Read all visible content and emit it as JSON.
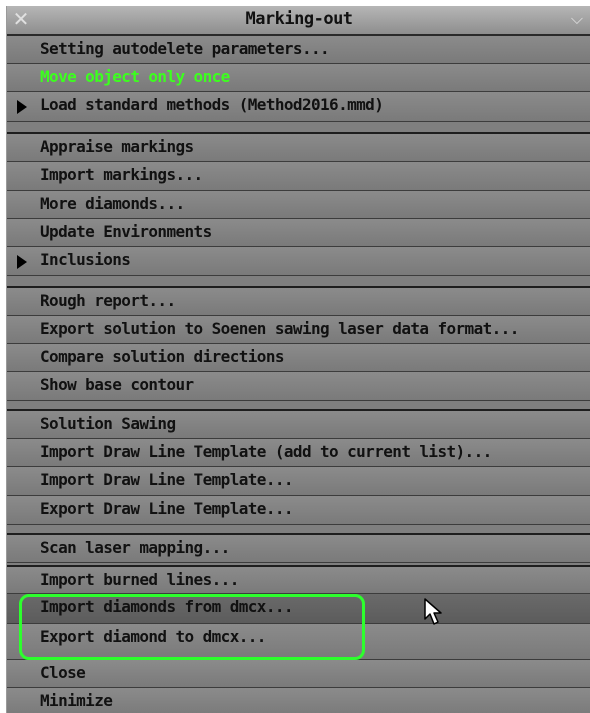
{
  "window": {
    "title": "Marking-out",
    "close_glyph": "✕",
    "dropdown_glyph": "⌵"
  },
  "items": [
    {
      "label": "Setting autodelete parameters..."
    },
    {
      "label": "Move object only once"
    },
    {
      "label": "Load standard methods (Method2016.mmd)"
    },
    {
      "label": "Appraise markings"
    },
    {
      "label": "Import markings..."
    },
    {
      "label": "More diamonds..."
    },
    {
      "label": "Update Environments"
    },
    {
      "label": "Inclusions"
    },
    {
      "label": "Rough report..."
    },
    {
      "label": "Export solution to Soenen sawing laser data format..."
    },
    {
      "label": "Compare solution directions"
    },
    {
      "label": "Show base contour"
    },
    {
      "label": "Solution Sawing"
    },
    {
      "label": "Import Draw Line Template (add to current list)..."
    },
    {
      "label": "Import Draw Line Template..."
    },
    {
      "label": "Export Draw Line Template..."
    },
    {
      "label": "Scan laser mapping..."
    },
    {
      "label": "Import burned lines..."
    },
    {
      "label": "Import diamonds from dmcx..."
    },
    {
      "label": "Export diamond to dmcx..."
    },
    {
      "label": "Close"
    },
    {
      "label": "Minimize"
    }
  ],
  "colors": {
    "highlighted_text": "#3cff1e",
    "annotation_outline": "#2dff2d"
  }
}
